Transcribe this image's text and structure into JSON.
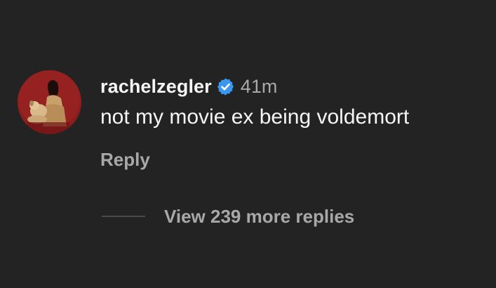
{
  "comment": {
    "username": "rachelzegler",
    "verified_icon": "verified-badge-icon",
    "verified_color": "#3897f0",
    "timestamp": "41m",
    "text": "not my movie ex being voldemort",
    "reply_label": "Reply",
    "view_replies_label": "View 239 more replies"
  },
  "colors": {
    "background": "#232323",
    "primary_text": "#f5f5f5",
    "secondary_text": "#a8a8a8",
    "avatar_background": "#8a1f1f"
  }
}
